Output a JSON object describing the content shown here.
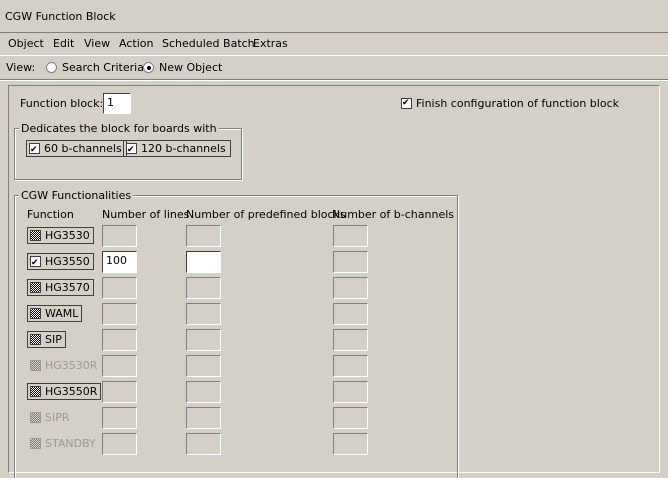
{
  "window": {
    "title": "CGW Function Block"
  },
  "menu": [
    "Object",
    "Edit",
    "View",
    "Action",
    "Scheduled Batch",
    "Extras"
  ],
  "view": {
    "label": "View:",
    "options": [
      {
        "label": "Search Criteria",
        "selected": false
      },
      {
        "label": "New Object",
        "selected": true
      }
    ]
  },
  "form": {
    "function_block_label": "Function block:",
    "function_block_value": "1",
    "finish_config_label": "Finish configuration of function block",
    "finish_config_checked": true
  },
  "dedicate": {
    "legend": "Dedicates the block for boards with",
    "options": [
      {
        "label": "60 b-channels",
        "checked": true
      },
      {
        "label": "120 b-channels",
        "checked": true
      }
    ]
  },
  "functionalities": {
    "legend": "CGW Functionalities",
    "headers": [
      "Function",
      "Number of lines",
      "Number of predefined blocks",
      "Number of b-channels"
    ],
    "rows": [
      {
        "name": "HG3530",
        "state": "indeterminate",
        "enabled": true,
        "lines": "",
        "blocks": ""
      },
      {
        "name": "HG3550",
        "state": "checked",
        "enabled": true,
        "lines": "100",
        "blocks": ""
      },
      {
        "name": "HG3570",
        "state": "indeterminate",
        "enabled": true,
        "lines": "",
        "blocks": ""
      },
      {
        "name": "WAML",
        "state": "indeterminate",
        "enabled": true,
        "lines": "",
        "blocks": ""
      },
      {
        "name": "SIP",
        "state": "indeterminate",
        "enabled": true,
        "lines": "",
        "blocks": ""
      },
      {
        "name": "HG3530R",
        "state": "indeterminate",
        "enabled": false,
        "lines": "",
        "blocks": ""
      },
      {
        "name": "HG3550R",
        "state": "indeterminate",
        "enabled": true,
        "lines": "",
        "blocks": ""
      },
      {
        "name": "SIPR",
        "state": "indeterminate",
        "enabled": false,
        "lines": "",
        "blocks": ""
      },
      {
        "name": "STANDBY",
        "state": "indeterminate",
        "enabled": false,
        "lines": "",
        "blocks": ""
      }
    ]
  }
}
